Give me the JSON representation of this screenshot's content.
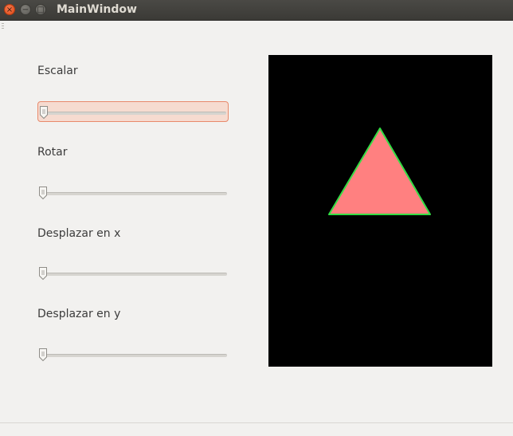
{
  "window": {
    "title": "MainWindow",
    "controls": {
      "close_icon": "×",
      "minimize_icon": "−",
      "maximize_icon": "□"
    }
  },
  "sliders": [
    {
      "label": "Escalar",
      "value": 0,
      "focused": true
    },
    {
      "label": "Rotar",
      "value": 0,
      "focused": false
    },
    {
      "label": "Desplazar en x",
      "value": 0,
      "focused": false
    },
    {
      "label": "Desplazar en y",
      "value": 0,
      "focused": false
    }
  ],
  "canvas": {
    "background": "#000000",
    "shape": "triangle",
    "fill": "#ff8080",
    "stroke": "#33dd44"
  },
  "colors": {
    "focus_border": "#e8896b",
    "focus_background": "#f6dbd0"
  }
}
